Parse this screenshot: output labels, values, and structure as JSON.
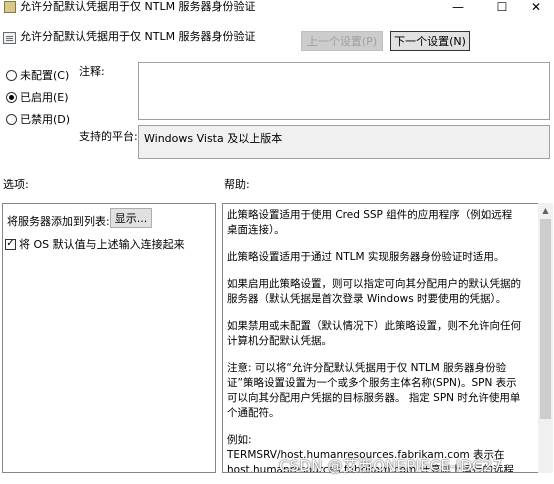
{
  "window": {
    "title": "允许分配默认凭据用于仅 NTLM 服务器身份验证",
    "minimize": "—",
    "maximize": "☐",
    "close": "✕"
  },
  "header": {
    "title": "允许分配默认凭据用于仅 NTLM 服务器身份验证",
    "prev_button": "上一个设置(P)",
    "next_button": "下一个设置(N)"
  },
  "state": {
    "options": [
      {
        "label": "未配置(C)",
        "checked": false
      },
      {
        "label": "已启用(E)",
        "checked": true
      },
      {
        "label": "已禁用(D)",
        "checked": false
      }
    ]
  },
  "comment": {
    "label": "注释:",
    "value": ""
  },
  "platform": {
    "label": "支持的平台:",
    "value": "Windows Vista 及以上版本"
  },
  "options_section": {
    "label": "选项:",
    "add_servers_label": "将服务器添加到列表:",
    "show_button": "显示...",
    "concat_checkbox_label": "将 OS 默认值与上述输入连接起来",
    "concat_checked": true
  },
  "help_section": {
    "label": "帮助:",
    "paragraphs": [
      "此策略设置适用于使用 Cred SSP 组件的应用程序（例如远程桌面连接）。",
      "此策略设置适用于通过 NTLM 实现服务器身份验证时适用。",
      "如果启用此策略设置，则可以指定可向其分配用户的默认凭据的服务器（默认凭据是首次登录 Windows 时要使用的凭据）。",
      "如果禁用或未配置（默认情况下）此策略设置，则不允许向任何计算机分配默认凭据。",
      "注意: 可以将“允许分配默认凭据用于仅 NTLM 服务器身份验证”策略设置设置为一个或多个服务主体名称(SPN)。SPN 表示可以向其分配用户凭据的目标服务器。 指定 SPN 时允许使用单个通配符。",
      "例如:",
      "TERMSRV/host.humanresources.fabrikam.com 表示在 host.humanresources.fabrikam.com 计算机上运行的远程桌面会话主机"
    ]
  },
  "watermark": "CSDN @艾西ONEPIECE-IDC27"
}
